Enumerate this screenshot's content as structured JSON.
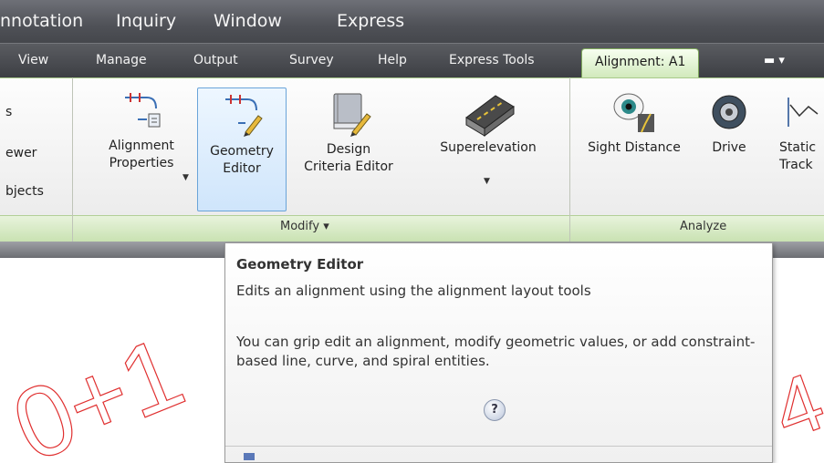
{
  "menubar": {
    "items": [
      "nnotation",
      "Inquiry",
      "Window",
      "Express"
    ]
  },
  "tabs": {
    "items": [
      "View",
      "Manage",
      "Output",
      "Survey",
      "Help",
      "Express Tools"
    ],
    "active": "Alignment: A1",
    "overflow_glyph": "▬ ▾"
  },
  "left_panel": {
    "items": [
      "s",
      "ewer",
      "bjects"
    ]
  },
  "modify_panel": {
    "title": "Modify ▾",
    "buttons": {
      "alignment_properties": [
        "Alignment",
        "Properties"
      ],
      "geometry_editor": [
        "Geometry",
        "Editor"
      ],
      "design_criteria_editor": [
        "Design",
        "Criteria Editor"
      ],
      "superelevation": [
        "Superelevation"
      ]
    }
  },
  "analyze_panel": {
    "title": "Analyze",
    "buttons": {
      "sight_distance": "Sight Distance",
      "drive": "Drive",
      "station_tracker": [
        "Static",
        "Track"
      ]
    }
  },
  "drawing": {
    "text_left": "0+1",
    "text_right": "4",
    "color": "#e03030"
  },
  "tooltip": {
    "title": "Geometry Editor",
    "description": "Edits an alignment using the alignment layout tools",
    "body": "You can grip edit an alignment, modify geometric values, or add constraint-based line, curve, and spiral entities.",
    "help_glyph": "?"
  },
  "colors": {
    "active_tab_bg": "#cfe8b9",
    "panel_title_bar": "#c9e2b2",
    "hover_button": "#cfe5fb",
    "menubar": "#4f5157"
  }
}
